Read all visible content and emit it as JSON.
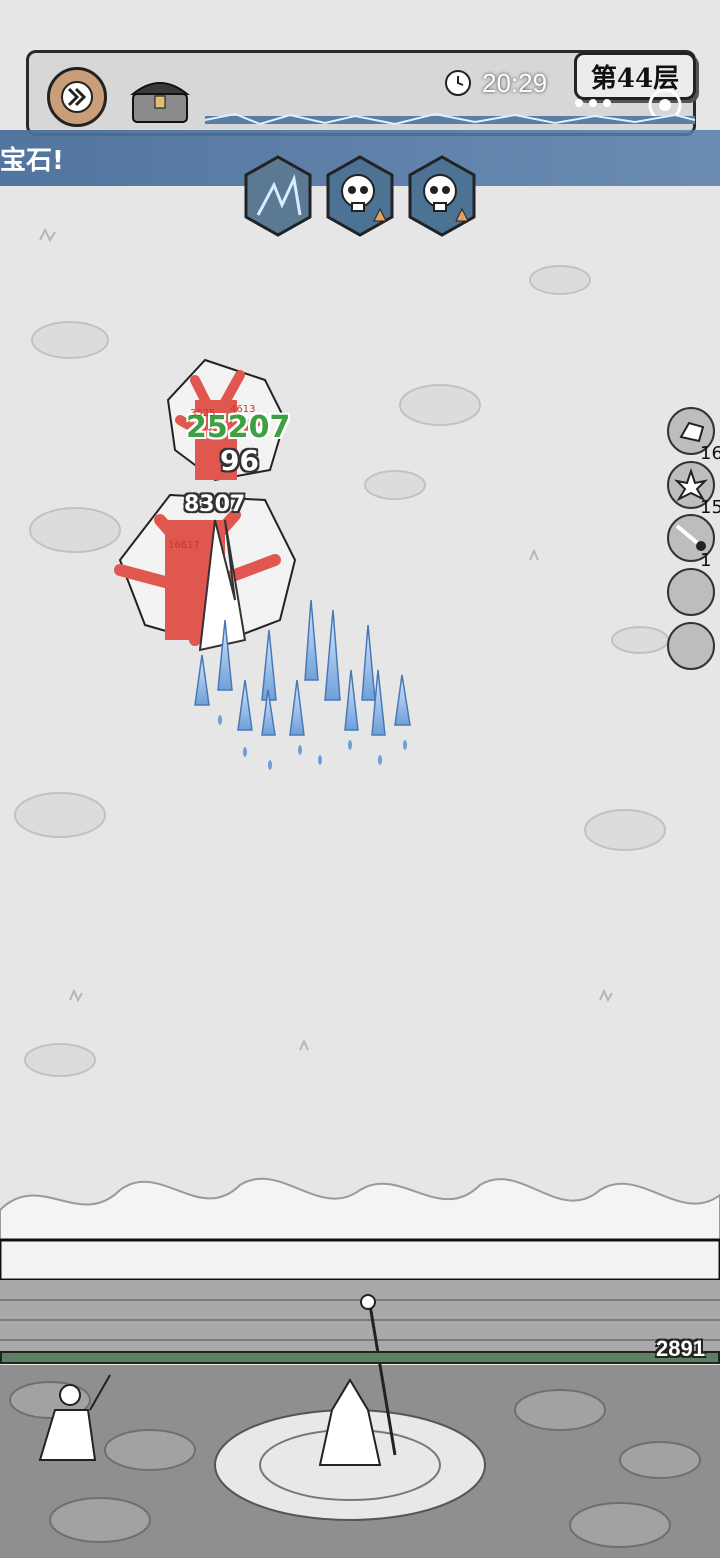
{
  "hud": {
    "fast_forward": "fast-forward",
    "chest": "treasure-chest",
    "timer": "20:29",
    "level": "第44层"
  },
  "banner": {
    "text": "宝石!"
  },
  "skills": [
    {
      "icon": "ice-shard-skill-icon"
    },
    {
      "icon": "skull-upgrade-icon"
    },
    {
      "icon": "skull-upgrade-icon"
    }
  ],
  "items": [
    {
      "icon": "gem-icon",
      "count": "16"
    },
    {
      "icon": "crystal-burst-icon",
      "count": "15"
    },
    {
      "icon": "comet-icon",
      "count": "1"
    },
    {
      "icon": "empty-slot",
      "count": ""
    },
    {
      "icon": "empty-slot",
      "count": ""
    }
  ],
  "damage": {
    "green": "25207",
    "white_1": "96",
    "white_2": "8307",
    "small_1": "3525",
    "small_2": "4613",
    "small_3": "16617"
  },
  "wall": {
    "hp": "2891"
  },
  "colors": {
    "banner": "#4a6f9b",
    "hp_bar": "#5d8062",
    "enemy": "#e0574f",
    "ice": "#8fb8e8"
  }
}
